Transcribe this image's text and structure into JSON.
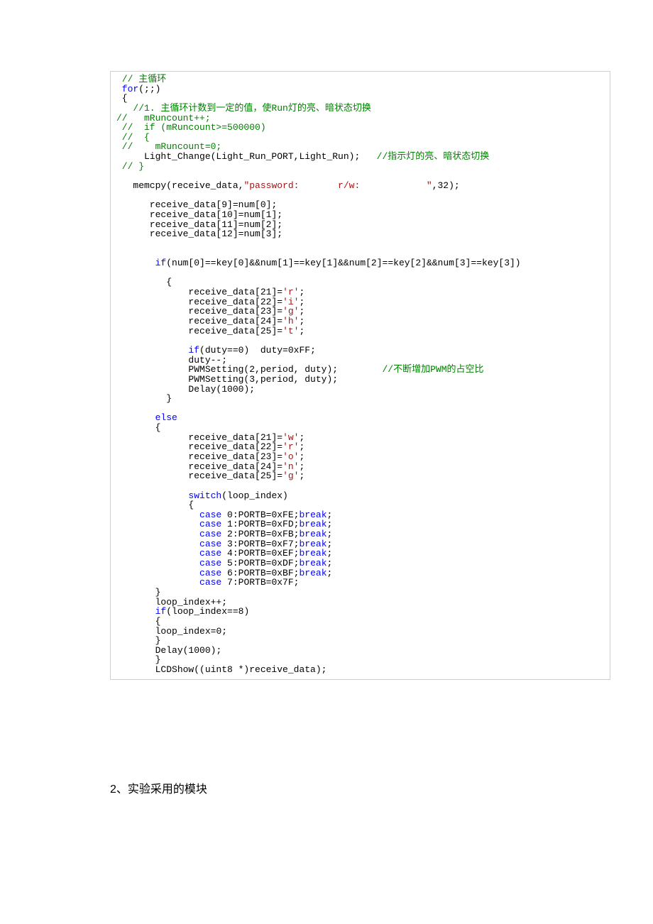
{
  "code": {
    "l01a": " // 主循环",
    "l02a": " for",
    "l02b": "(;;)",
    "l03a": " {",
    "l04a": "   //1. 主循环计数到一定的值，使Run灯的亮、暗状态切换",
    "l05a": "//   mRuncount++;",
    "l06a": " //  if (mRuncount>=500000)",
    "l07a": " //  {",
    "l08a": " //    mRuncount=0;",
    "l09a": "     Light_Change(Light_Run_PORT,Light_Run);   ",
    "l09b": "//指示灯的亮、暗状态切换",
    "l10a": " // }",
    "l11a": "",
    "l12a": "   memcpy(receive_data,",
    "l12b": "\"password:       r/w:            \"",
    "l12c": ",",
    "l12d": "32",
    "l12e": ");",
    "l13a": "",
    "l14a": "      receive_data[",
    "l14b": "9",
    "l14c": "]=num[",
    "l14d": "0",
    "l14e": "];",
    "l15a": "      receive_data[",
    "l15b": "10",
    "l15c": "]=num[",
    "l15d": "1",
    "l15e": "];",
    "l16a": "      receive_data[",
    "l16b": "11",
    "l16c": "]=num[",
    "l16d": "2",
    "l16e": "];",
    "l17a": "      receive_data[",
    "l17b": "12",
    "l17c": "]=num[",
    "l17d": "3",
    "l17e": "];",
    "l18a": "",
    "l19a": "",
    "l20a": "       if",
    "l20b": "(num[",
    "l20c": "0",
    "l20d": "]==key[",
    "l20e": "0",
    "l20f": "]&&num[",
    "l20g": "1",
    "l20h": "]==key[",
    "l20i": "1",
    "l20j": "]&&num[",
    "l20k": "2",
    "l20l": "]==key[",
    "l20m": "2",
    "l20n": "]&&num[",
    "l20o": "3",
    "l20p": "]==key[",
    "l20q": "3",
    "l20r": "])",
    "l21a": "",
    "l22a": "         {",
    "l23a": "             receive_data[",
    "l23b": "21",
    "l23c": "]=",
    "l23d": "'r'",
    "l23e": ";",
    "l24a": "             receive_data[",
    "l24b": "22",
    "l24c": "]=",
    "l24d": "'i'",
    "l24e": ";",
    "l25a": "             receive_data[",
    "l25b": "23",
    "l25c": "]=",
    "l25d": "'g'",
    "l25e": ";",
    "l26a": "             receive_data[",
    "l26b": "24",
    "l26c": "]=",
    "l26d": "'h'",
    "l26e": ";",
    "l27a": "             receive_data[",
    "l27b": "25",
    "l27c": "]=",
    "l27d": "'t'",
    "l27e": ";",
    "l28a": "",
    "l29a": "             if",
    "l29b": "(duty==",
    "l29c": "0",
    "l29d": ")  duty=",
    "l29e": "0xFF",
    "l29f": ";",
    "l30a": "             duty--;",
    "l31a": "             PWMSetting(",
    "l31b": "2",
    "l31c": ",period, duty);        ",
    "l31d": "//不断增加PWM的占空比",
    "l32a": "             PWMSetting(",
    "l32b": "3",
    "l32c": ",period, duty);",
    "l33a": "             Delay(",
    "l33b": "1000",
    "l33c": ");",
    "l34a": "         }",
    "l35a": "",
    "l36a": "       else",
    "l37a": "       {",
    "l38a": "             receive_data[",
    "l38b": "21",
    "l38c": "]=",
    "l38d": "'w'",
    "l38e": ";",
    "l39a": "             receive_data[",
    "l39b": "22",
    "l39c": "]=",
    "l39d": "'r'",
    "l39e": ";",
    "l40a": "             receive_data[",
    "l40b": "23",
    "l40c": "]=",
    "l40d": "'o'",
    "l40e": ";",
    "l41a": "             receive_data[",
    "l41b": "24",
    "l41c": "]=",
    "l41d": "'n'",
    "l41e": ";",
    "l42a": "             receive_data[",
    "l42b": "25",
    "l42c": "]=",
    "l42d": "'g'",
    "l42e": ";",
    "l43a": "",
    "l44a": "             switch",
    "l44b": "(loop_index)",
    "l45a": "             {",
    "l46a": "               case ",
    "l46b": "0",
    "l46c": ":PORTB=",
    "l46d": "0xFE",
    "l46e": ";",
    "l46f": "break",
    "l46g": ";",
    "l47a": "               case ",
    "l47b": "1",
    "l47c": ":PORTB=",
    "l47d": "0xFD",
    "l47e": ";",
    "l47f": "break",
    "l47g": ";",
    "l48a": "               case ",
    "l48b": "2",
    "l48c": ":PORTB=",
    "l48d": "0xFB",
    "l48e": ";",
    "l48f": "break",
    "l48g": ";",
    "l49a": "               case ",
    "l49b": "3",
    "l49c": ":PORTB=",
    "l49d": "0xF7",
    "l49e": ";",
    "l49f": "break",
    "l49g": ";",
    "l50a": "               case ",
    "l50b": "4",
    "l50c": ":PORTB=",
    "l50d": "0xEF",
    "l50e": ";",
    "l50f": "break",
    "l50g": ";",
    "l51a": "               case ",
    "l51b": "5",
    "l51c": ":PORTB=",
    "l51d": "0xDF",
    "l51e": ";",
    "l51f": "break",
    "l51g": ";",
    "l52a": "               case ",
    "l52b": "6",
    "l52c": ":PORTB=",
    "l52d": "0xBF",
    "l52e": ";",
    "l52f": "break",
    "l52g": ";",
    "l53a": "               case ",
    "l53b": "7",
    "l53c": ":PORTB=",
    "l53d": "0x7F",
    "l53e": ";",
    "l54a": "       }",
    "l55a": "       loop_index++;",
    "l56a": "       if",
    "l56b": "(loop_index==",
    "l56c": "8",
    "l56d": ")",
    "l57a": "       {",
    "l58a": "       loop_index=",
    "l58b": "0",
    "l58c": ";",
    "l59a": "       }",
    "l60a": "       Delay(",
    "l60b": "1000",
    "l60c": ");",
    "l61a": "       }",
    "l62a": "       LCDShow((uint8 *)receive_data);"
  },
  "section": "2、实验采用的模块"
}
